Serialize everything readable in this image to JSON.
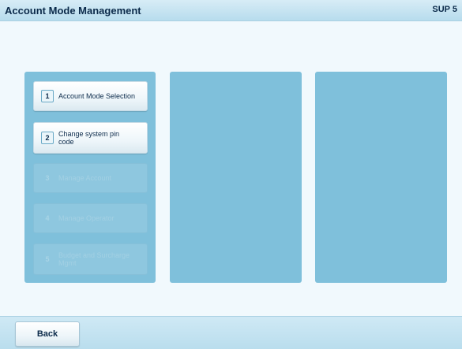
{
  "header": {
    "title": "Account Mode Management",
    "code": "SUP 5"
  },
  "menu": {
    "items": [
      {
        "number": "1",
        "label": "Account Mode Selection",
        "enabled": true
      },
      {
        "number": "2",
        "label": "Change system pin code",
        "enabled": true
      },
      {
        "number": "3",
        "label": "Manage Account",
        "enabled": false
      },
      {
        "number": "4",
        "label": "Manage Operator",
        "enabled": false
      },
      {
        "number": "5",
        "label": "Budget and Surcharge Mgmt",
        "enabled": false
      }
    ]
  },
  "footer": {
    "back_label": "Back"
  }
}
